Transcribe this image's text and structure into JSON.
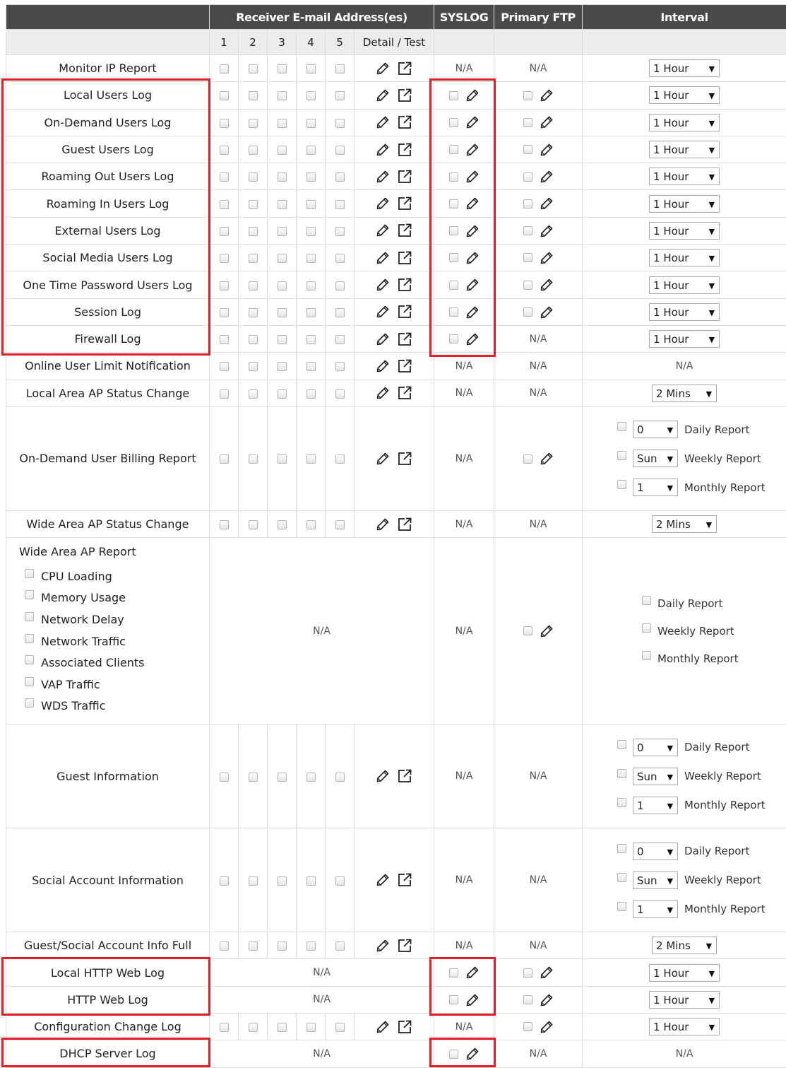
{
  "header": {
    "receiver": "Receiver E-mail Address(es)",
    "syslog": "SYSLOG",
    "ftp": "Primary FTP",
    "interval": "Interval",
    "cols": [
      "1",
      "2",
      "3",
      "4",
      "5"
    ],
    "detail": "Detail / Test"
  },
  "na": "N/A",
  "schedule": {
    "daily_value": "0",
    "weekly_value": "Sun",
    "monthly_value": "1",
    "daily_label": "Daily Report",
    "weekly_label": "Weekly Report",
    "monthly_label": "Monthly Report"
  },
  "wide_area_report": {
    "title": "Wide Area AP Report",
    "items": [
      "CPU Loading",
      "Memory Usage",
      "Network Delay",
      "Network Traffic",
      "Associated Clients",
      "VAP Traffic",
      "WDS Traffic"
    ]
  },
  "rows": [
    {
      "name": "Monitor IP Report",
      "email": "checks",
      "syslog": "na",
      "ftp": "na",
      "interval": "1 Hour"
    },
    {
      "name": "Local Users Log",
      "email": "checks",
      "syslog": "edit",
      "ftp": "edit",
      "interval": "1 Hour"
    },
    {
      "name": "On-Demand Users Log",
      "email": "checks",
      "syslog": "edit",
      "ftp": "edit",
      "interval": "1 Hour"
    },
    {
      "name": "Guest Users Log",
      "email": "checks",
      "syslog": "edit",
      "ftp": "edit",
      "interval": "1 Hour"
    },
    {
      "name": "Roaming Out Users Log",
      "email": "checks",
      "syslog": "edit",
      "ftp": "edit",
      "interval": "1 Hour"
    },
    {
      "name": "Roaming In Users Log",
      "email": "checks",
      "syslog": "edit",
      "ftp": "edit",
      "interval": "1 Hour"
    },
    {
      "name": "External Users Log",
      "email": "checks",
      "syslog": "edit",
      "ftp": "edit",
      "interval": "1 Hour"
    },
    {
      "name": "Social Media Users Log",
      "email": "checks",
      "syslog": "edit",
      "ftp": "edit",
      "interval": "1 Hour"
    },
    {
      "name": "One Time Password Users Log",
      "email": "checks",
      "syslog": "edit",
      "ftp": "edit",
      "interval": "1 Hour"
    },
    {
      "name": "Session Log",
      "email": "checks",
      "syslog": "edit",
      "ftp": "edit",
      "interval": "1 Hour"
    },
    {
      "name": "Firewall Log",
      "email": "checks",
      "syslog": "edit",
      "ftp": "na",
      "interval": "1 Hour"
    },
    {
      "name": "Online User Limit Notification",
      "email": "checks",
      "syslog": "na",
      "ftp": "na",
      "interval": "na"
    },
    {
      "name": "Local Area AP Status Change",
      "email": "checks",
      "syslog": "na",
      "ftp": "na",
      "interval": "2 Mins"
    },
    {
      "name": "On-Demand User Billing Report",
      "email": "checks",
      "syslog": "na",
      "ftp": "edit",
      "interval": "schedule",
      "tall": true
    },
    {
      "name": "Wide Area AP Status Change",
      "email": "checks",
      "syslog": "na",
      "ftp": "na",
      "interval": "2 Mins"
    },
    {
      "name": "Wide Area AP Report",
      "special": "wide",
      "email": "na",
      "syslog": "na",
      "ftp": "edit",
      "interval": "reports3"
    },
    {
      "name": "Guest Information",
      "email": "checks",
      "syslog": "na",
      "ftp": "na",
      "interval": "schedule",
      "tall": true
    },
    {
      "name": "Social Account Information",
      "email": "checks",
      "syslog": "na",
      "ftp": "na",
      "interval": "schedule",
      "tall": true
    },
    {
      "name": "Guest/Social Account Info Full",
      "email": "checks",
      "syslog": "na",
      "ftp": "na",
      "interval": "2 Mins"
    },
    {
      "name": "Local HTTP Web Log",
      "email": "na",
      "syslog": "edit",
      "ftp": "edit",
      "interval": "1 Hour"
    },
    {
      "name": "HTTP Web Log",
      "email": "na",
      "syslog": "edit",
      "ftp": "edit",
      "interval": "1 Hour"
    },
    {
      "name": "Configuration Change Log",
      "email": "checks",
      "syslog": "na",
      "ftp": "edit",
      "interval": "1 Hour"
    },
    {
      "name": "DHCP Server Log",
      "email": "na",
      "syslog": "edit",
      "ftp": "na",
      "interval": "na"
    }
  ],
  "highlight_color": "#e11f26"
}
